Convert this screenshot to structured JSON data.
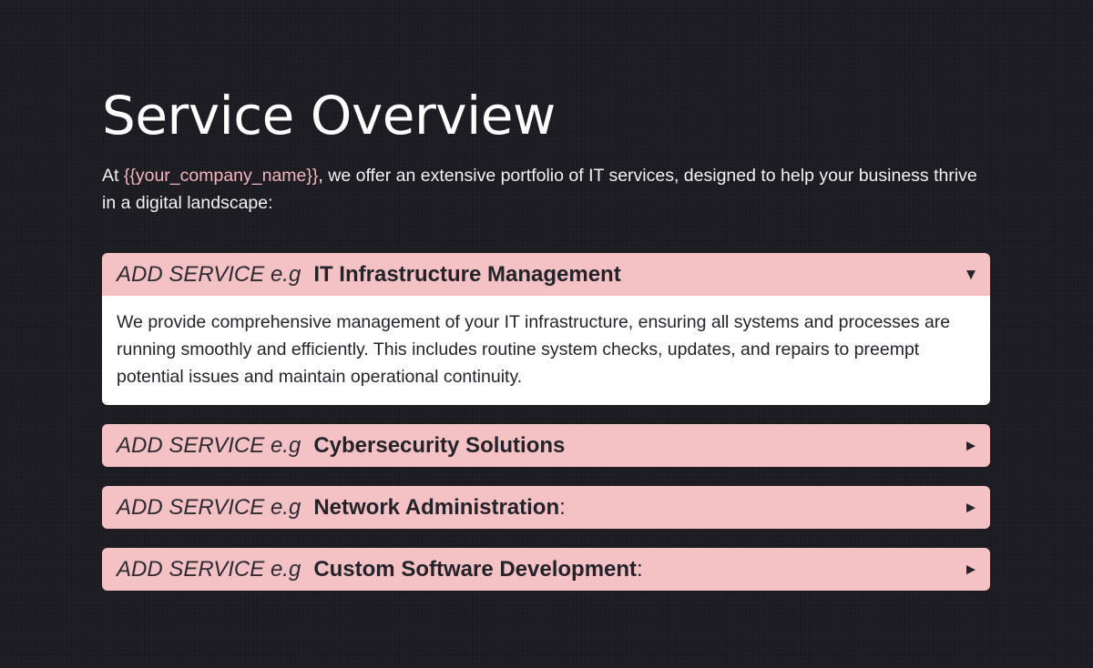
{
  "page": {
    "title": "Service Overview",
    "intro": {
      "prefix": "At ",
      "placeholder": "{{your_company_name}}",
      "suffix": ", we offer an extensive portfolio of IT services, designed to help your business thrive in a digital landscape:"
    }
  },
  "accordion": {
    "items": [
      {
        "prefix": "ADD SERVICE e.g",
        "name": "IT Infrastructure Management",
        "suffix": "",
        "caret": "▼",
        "expanded": true,
        "body": "We provide comprehensive management of your IT infrastructure, ensuring all systems and processes are running smoothly and efficiently. This includes routine system checks, updates, and repairs to preempt potential issues and maintain operational continuity."
      },
      {
        "prefix": "ADD SERVICE e.g",
        "name": "Cybersecurity Solutions",
        "suffix": "",
        "caret": "▶",
        "expanded": false
      },
      {
        "prefix": "ADD SERVICE e.g",
        "name": "Network Administration",
        "suffix": ":",
        "caret": "▶",
        "expanded": false
      },
      {
        "prefix": "ADD SERVICE e.g",
        "name": "Custom Software Development",
        "suffix": ":",
        "caret": "▶",
        "expanded": false
      }
    ]
  },
  "colors": {
    "background": "#1c1b21",
    "header_pink": "#f4c1c4",
    "placeholder_pink": "#f3b6bf",
    "body_white": "#ffffff",
    "text_dark": "#24222a"
  }
}
